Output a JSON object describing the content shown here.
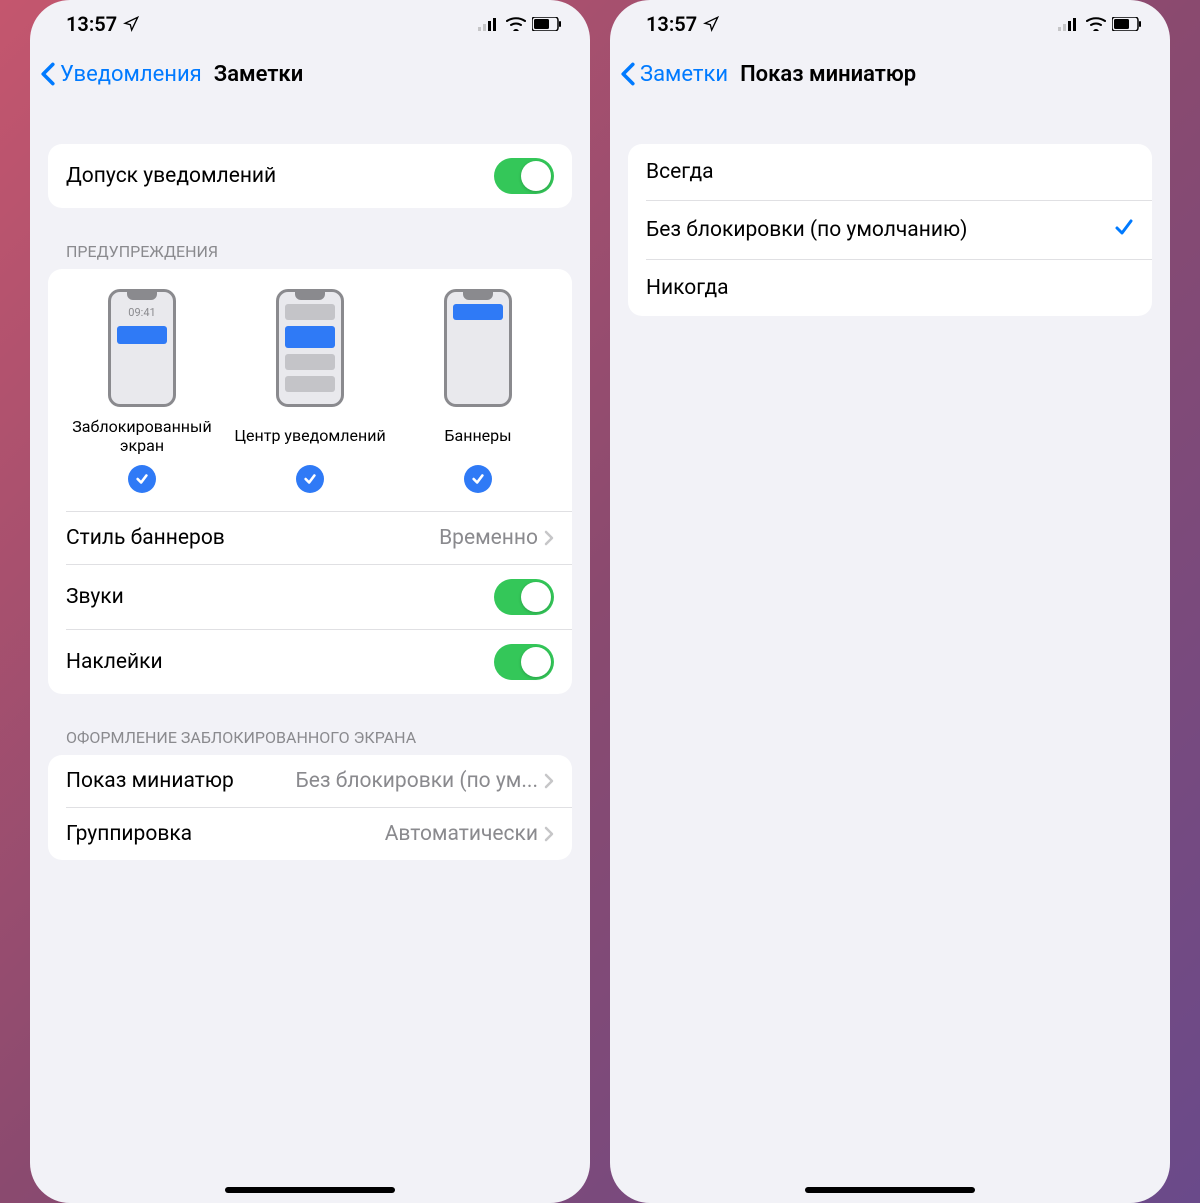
{
  "status": {
    "time": "13:57"
  },
  "left": {
    "nav": {
      "back": "Уведомления",
      "title": "Заметки"
    },
    "allow": {
      "label": "Допуск уведомлений",
      "on": true
    },
    "alerts": {
      "header": "ПРЕДУПРЕЖДЕНИЯ",
      "lock_time": "09:41",
      "options": [
        {
          "label": "Заблокированный экран",
          "checked": true
        },
        {
          "label": "Центр уведомлений",
          "checked": true
        },
        {
          "label": "Баннеры",
          "checked": true
        }
      ],
      "banner_style": {
        "label": "Стиль баннеров",
        "value": "Временно"
      },
      "sounds": {
        "label": "Звуки",
        "on": true
      },
      "badges": {
        "label": "Наклейки",
        "on": true
      }
    },
    "lockscreen": {
      "header": "ОФОРМЛЕНИЕ ЗАБЛОКИРОВАННОГО ЭКРАНА",
      "previews": {
        "label": "Показ миниатюр",
        "value": "Без блокировки (по ум..."
      },
      "grouping": {
        "label": "Группировка",
        "value": "Автоматически"
      }
    }
  },
  "right": {
    "nav": {
      "back": "Заметки",
      "title": "Показ миниатюр"
    },
    "list": [
      {
        "label": "Всегда",
        "selected": false
      },
      {
        "label": "Без блокировки (по умолчанию)",
        "selected": true
      },
      {
        "label": "Никогда",
        "selected": false
      }
    ]
  }
}
